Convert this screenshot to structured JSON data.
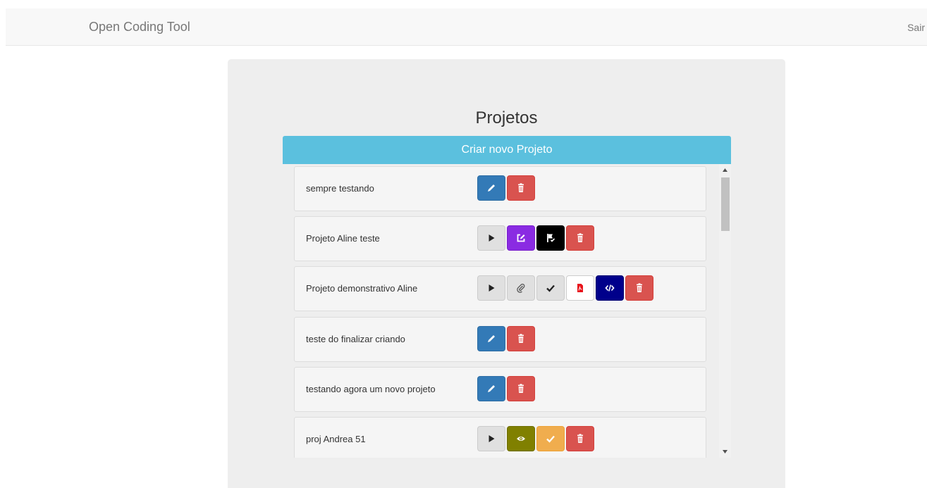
{
  "navbar": {
    "brand": "Open Coding Tool",
    "logout": "Sair"
  },
  "page": {
    "title": "Projetos",
    "create_button": "Criar novo Projeto"
  },
  "projects": [
    {
      "name": "sempre testando",
      "actions": [
        "edit-button",
        "delete-button"
      ]
    },
    {
      "name": "Projeto Aline teste",
      "actions": [
        "play-button",
        "review-button",
        "flag-button",
        "delete-button"
      ]
    },
    {
      "name": "Projeto demonstrativo Aline",
      "actions": [
        "play-button",
        "attach-button",
        "check-button",
        "pdf-button",
        "code-button",
        "delete-button"
      ]
    },
    {
      "name": "teste do finalizar criando",
      "actions": [
        "edit-button",
        "delete-button"
      ]
    },
    {
      "name": "testando agora um novo projeto",
      "actions": [
        "edit-button",
        "delete-button"
      ]
    },
    {
      "name": "proj Andrea 51",
      "actions": [
        "play-button",
        "view-button",
        "check-button",
        "delete-button"
      ]
    }
  ],
  "colors": {
    "primary": "#337ab7",
    "danger": "#d9534f",
    "info": "#5bc0de",
    "purple": "#8a2be2",
    "navy": "#00008b",
    "olive": "#808000",
    "warning": "#f0ad4e"
  }
}
